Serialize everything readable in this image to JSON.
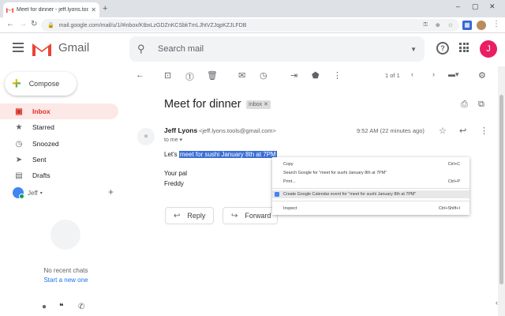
{
  "browser": {
    "tab_title": "Meet for dinner - jeff.lyons.tools",
    "url": "mail.google.com/mail/u/1/#inbox/KtbxLzGDZnKCSbkTmLJhtVZJqpKZJLFDB",
    "window_controls": [
      "–",
      "▢",
      "✕"
    ]
  },
  "gmail": {
    "app_name": "Gmail",
    "search_placeholder": "Search mail",
    "avatar_letter": "J",
    "compose_label": "Compose",
    "nav": [
      {
        "label": "Inbox",
        "icon": "inbox-icon",
        "active": true
      },
      {
        "label": "Starred",
        "icon": "star-icon"
      },
      {
        "label": "Snoozed",
        "icon": "clock-icon"
      },
      {
        "label": "Sent",
        "icon": "send-icon"
      },
      {
        "label": "Drafts",
        "icon": "draft-icon"
      }
    ],
    "hangouts": {
      "user": "Jeff",
      "no_chats": "No recent chats",
      "start_new": "Start a new one"
    },
    "pager": "1 of 1"
  },
  "message": {
    "subject": "Meet for dinner",
    "label_chip": "Inbox",
    "sender_name": "Jeff Lyons",
    "sender_email": "<jeff.lyons.tools@gmail.com>",
    "to": "to me",
    "time": "9:52 AM (22 minutes ago)",
    "body_prefix": "Let's ",
    "body_selected": "meet for sushi January 8th at 7PM",
    "signoff": "Your pal",
    "signature": "Freddy",
    "reply_label": "Reply",
    "forward_label": "Forward"
  },
  "context_menu": {
    "copy": {
      "label": "Copy",
      "shortcut": "Ctrl+C"
    },
    "search": {
      "label": "Search Google for \"meet for sushi January 8th at 7PM\"",
      "shortcut": ""
    },
    "print": {
      "label": "Print...",
      "shortcut": "Ctrl+P"
    },
    "calendar": {
      "label": "Create Google Calendar event for \"meet for sushi January 8th at 7PM\"",
      "shortcut": ""
    },
    "inspect": {
      "label": "Inspect",
      "shortcut": "Ctrl+Shift+I"
    }
  },
  "colors": {
    "gmail_red": "#d93025",
    "selection_blue": "#3b6fd4",
    "avatar_pink": "#e91e63"
  }
}
